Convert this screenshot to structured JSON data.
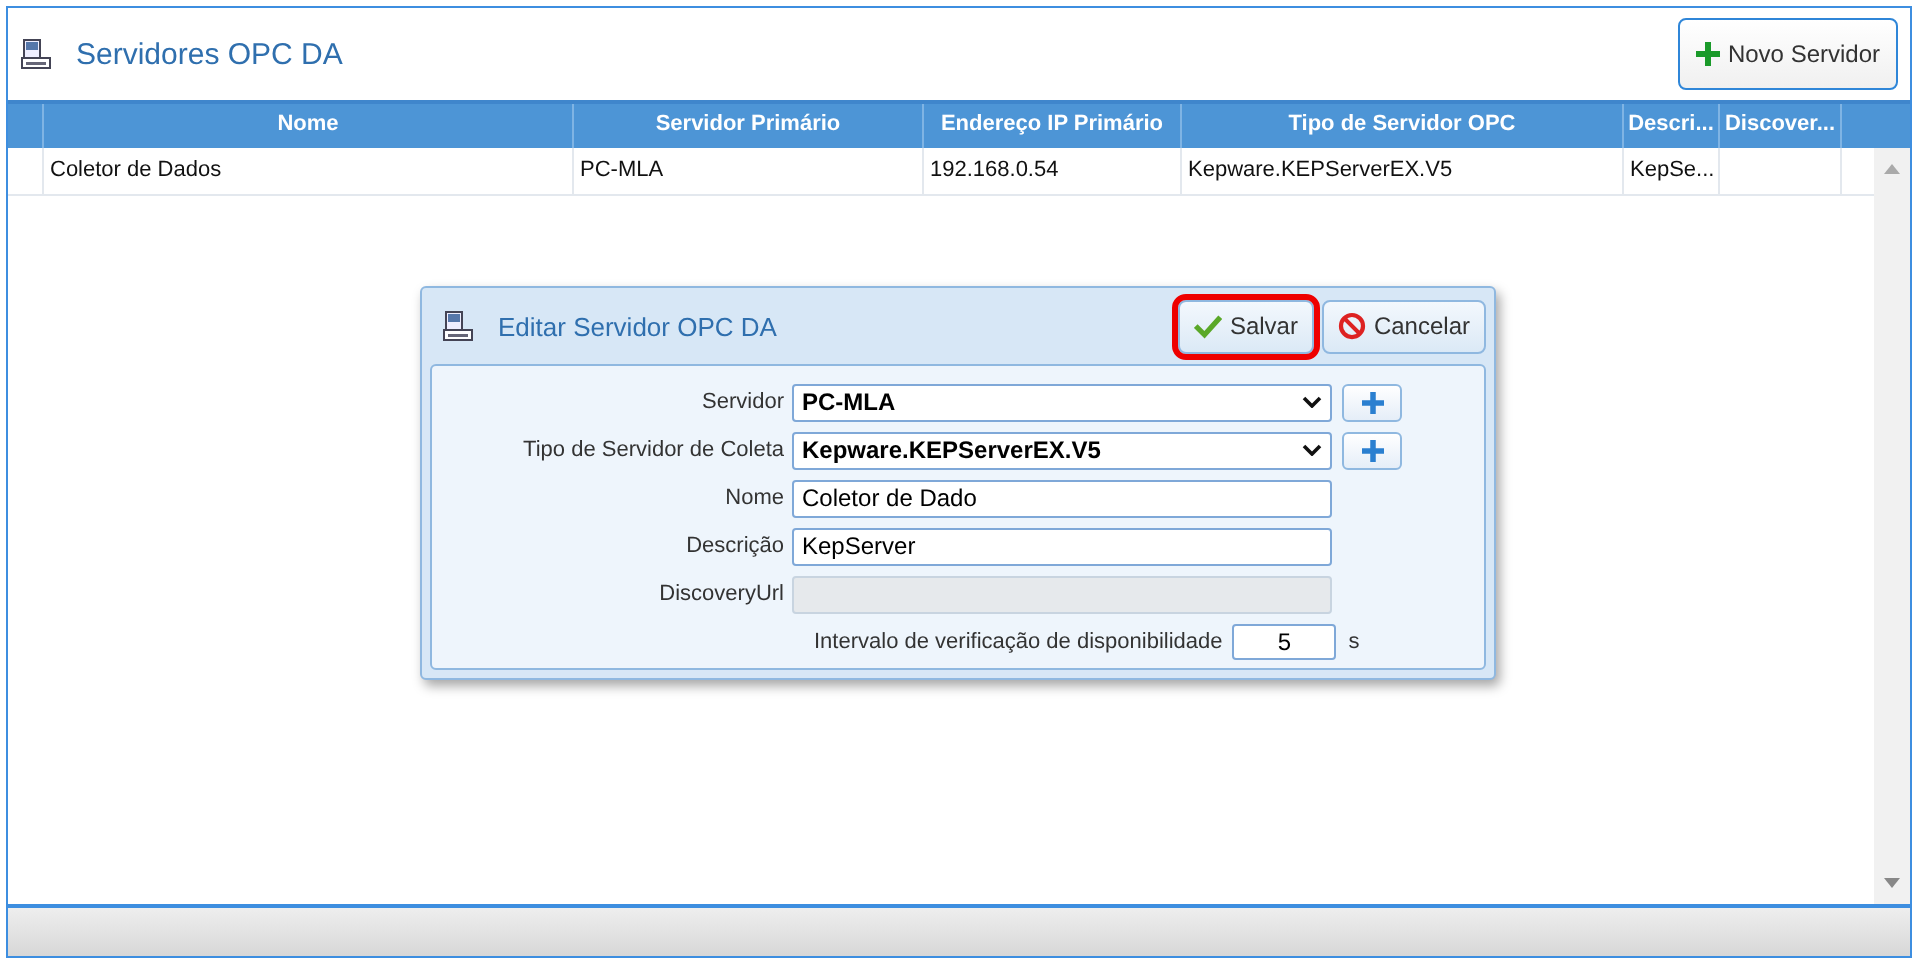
{
  "page": {
    "title": "Servidores OPC DA",
    "new_button": "Novo Servidor"
  },
  "table": {
    "columns": [
      "Nome",
      "Servidor Primário",
      "Endereço IP Primário",
      "Tipo de Servidor OPC",
      "Descri...",
      "Discover..."
    ],
    "rows": [
      [
        "Coletor de Dados",
        "PC-MLA",
        "192.168.0.54",
        "Kepware.KEPServerEX.V5",
        "KepSe...",
        ""
      ]
    ]
  },
  "dialog": {
    "title": "Editar Servidor OPC DA",
    "buttons": [
      {
        "label": "Salvar",
        "kind": "save",
        "highlighted": true
      },
      {
        "label": "Cancelar",
        "kind": "cancel",
        "highlighted": false
      }
    ],
    "fields": [
      {
        "label": "Servidor",
        "kind": "select",
        "value": "PC-MLA",
        "disabled": false
      },
      {
        "label": "Tipo de Servidor de Coleta",
        "kind": "select",
        "value": "Kepware.KEPServerEX.V5",
        "disabled": false
      },
      {
        "label": "Nome",
        "kind": "text",
        "value": "Coletor de Dado",
        "disabled": false
      },
      {
        "label": "Descrição",
        "kind": "text",
        "value": "KepServer",
        "disabled": false
      },
      {
        "label": "DiscoveryUrl",
        "kind": "text",
        "disabled": true
      }
    ],
    "interval": {
      "label": "Intervalo de verificação de disponibilidade",
      "value": "5",
      "unit": "s"
    }
  }
}
